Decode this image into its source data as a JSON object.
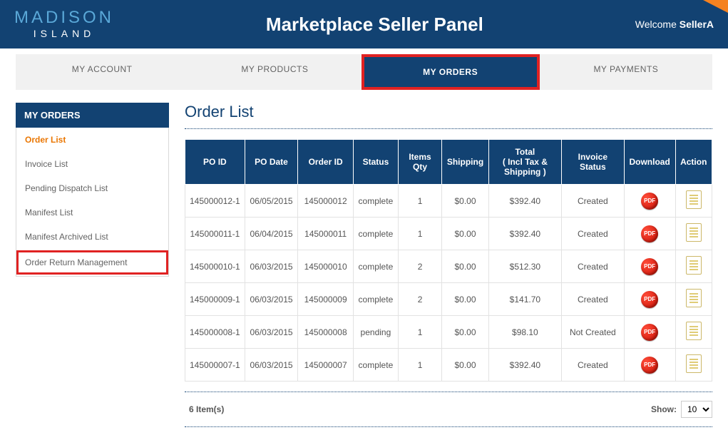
{
  "header": {
    "logo_top": "MADISON",
    "logo_bottom": "ISLAND",
    "title": "Marketplace Seller Panel",
    "welcome_prefix": "Welcome ",
    "welcome_user": "SellerA"
  },
  "tabs": [
    {
      "label": "MY ACCOUNT",
      "active": false
    },
    {
      "label": "MY PRODUCTS",
      "active": false
    },
    {
      "label": "MY ORDERS",
      "active": true
    },
    {
      "label": "MY PAYMENTS",
      "active": false
    }
  ],
  "sidebar": {
    "header": "MY ORDERS",
    "items": [
      {
        "label": "Order List",
        "selected": true
      },
      {
        "label": "Invoice List"
      },
      {
        "label": "Pending Dispatch List"
      },
      {
        "label": "Manifest List"
      },
      {
        "label": "Manifest Archived List"
      },
      {
        "label": "Order Return Management",
        "highlighted": true
      }
    ]
  },
  "main": {
    "title": "Order List",
    "columns": [
      "PO ID",
      "PO Date",
      "Order ID",
      "Status",
      "Items Qty",
      "Shipping",
      "Total\n( Incl Tax & Shipping )",
      "Invoice Status",
      "Download",
      "Action"
    ],
    "rows": [
      {
        "po_id": "145000012-1",
        "po_date": "06/05/2015",
        "order_id": "145000012",
        "status": "complete",
        "qty": "1",
        "shipping": "$0.00",
        "total": "$392.40",
        "invoice_status": "Created"
      },
      {
        "po_id": "145000011-1",
        "po_date": "06/04/2015",
        "order_id": "145000011",
        "status": "complete",
        "qty": "1",
        "shipping": "$0.00",
        "total": "$392.40",
        "invoice_status": "Created"
      },
      {
        "po_id": "145000010-1",
        "po_date": "06/03/2015",
        "order_id": "145000010",
        "status": "complete",
        "qty": "2",
        "shipping": "$0.00",
        "total": "$512.30",
        "invoice_status": "Created"
      },
      {
        "po_id": "145000009-1",
        "po_date": "06/03/2015",
        "order_id": "145000009",
        "status": "complete",
        "qty": "2",
        "shipping": "$0.00",
        "total": "$141.70",
        "invoice_status": "Created"
      },
      {
        "po_id": "145000008-1",
        "po_date": "06/03/2015",
        "order_id": "145000008",
        "status": "pending",
        "qty": "1",
        "shipping": "$0.00",
        "total": "$98.10",
        "invoice_status": "Not Created"
      },
      {
        "po_id": "145000007-1",
        "po_date": "06/03/2015",
        "order_id": "145000007",
        "status": "complete",
        "qty": "1",
        "shipping": "$0.00",
        "total": "$392.40",
        "invoice_status": "Created"
      }
    ],
    "item_count": "6 Item(s)",
    "show_label": "Show:",
    "show_value": "10"
  },
  "pdf_label": "PDF"
}
